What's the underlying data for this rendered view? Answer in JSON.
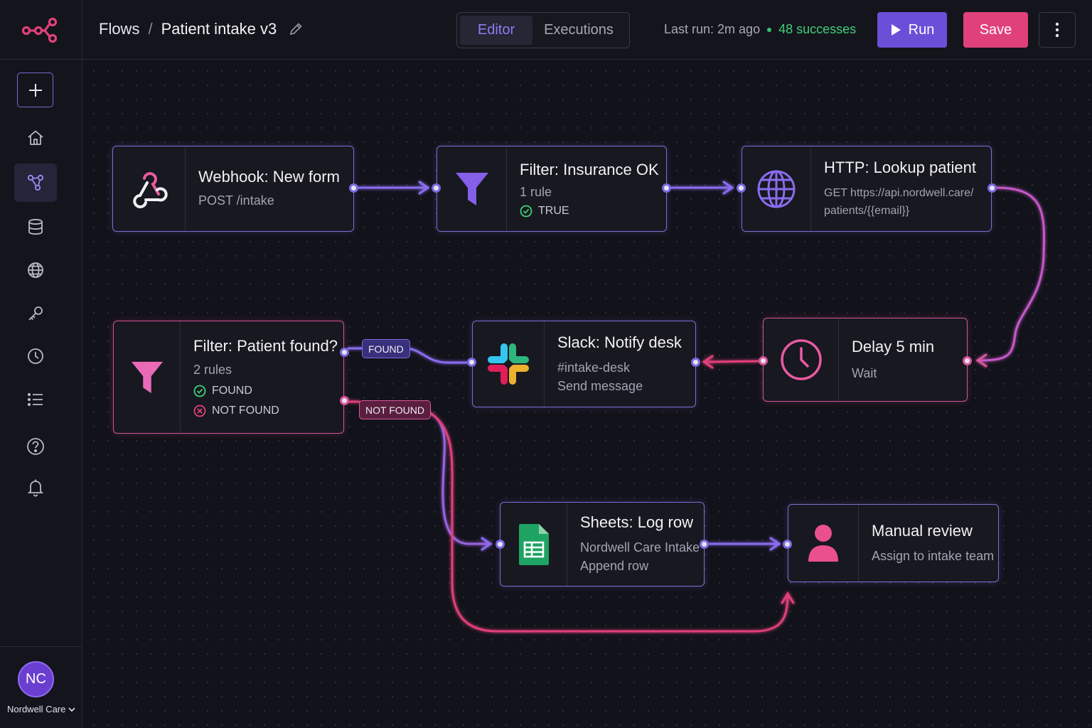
{
  "header": {
    "breadcrumb_root": "Flows",
    "breadcrumb_sep": "/",
    "flow_name": "Patient intake v3",
    "tabs": [
      {
        "label": "Editor",
        "active": true
      },
      {
        "label": "Executions",
        "active": false
      }
    ],
    "last_run": "Last run: 2m ago",
    "successes": "48 successes",
    "run_label": "Run",
    "save_label": "Save"
  },
  "sidebar": {
    "items": [
      {
        "icon": "plus-icon"
      },
      {
        "icon": "home-icon"
      },
      {
        "icon": "workflow-icon",
        "active": true
      },
      {
        "icon": "database-icon"
      },
      {
        "icon": "globe-icon"
      },
      {
        "icon": "key-icon"
      },
      {
        "icon": "clock-icon"
      },
      {
        "icon": "list-icon"
      },
      {
        "icon": "help-icon"
      },
      {
        "icon": "bell-icon"
      }
    ],
    "user_initials": "NC",
    "org_name": "Nordwell Care"
  },
  "nodes": {
    "webhook": {
      "title": "Webhook: New form",
      "sub": "POST /intake"
    },
    "filter_insurance": {
      "title": "Filter: Insurance OK",
      "sub": "1 rule",
      "rule": "TRUE"
    },
    "http": {
      "title": "HTTP: Lookup patient",
      "line1": "GET https://api.nordwell.care/",
      "line2": "patients/{{email}}"
    },
    "filter_patient": {
      "title": "Filter: Patient found?",
      "sub": "2 rules",
      "rule1": "FOUND",
      "rule2": "NOT FOUND"
    },
    "slack": {
      "title": "Slack: Notify desk",
      "line1": "#intake-desk",
      "line2": "Send message"
    },
    "delay": {
      "title": "Delay 5 min",
      "sub": "Wait"
    },
    "sheets": {
      "title": "Sheets: Log row",
      "line1": "Nordwell Care Intake",
      "line2": "Append row"
    },
    "manual": {
      "title": "Manual review",
      "sub": "Assign to intake team"
    }
  },
  "edge_labels": {
    "found": "FOUND",
    "not_found": "NOT FOUND"
  },
  "colors": {
    "accent_purple": "#7b6fd6",
    "accent_pink": "#e0417a",
    "success_green": "#3fd07a",
    "background": "#12121a"
  }
}
